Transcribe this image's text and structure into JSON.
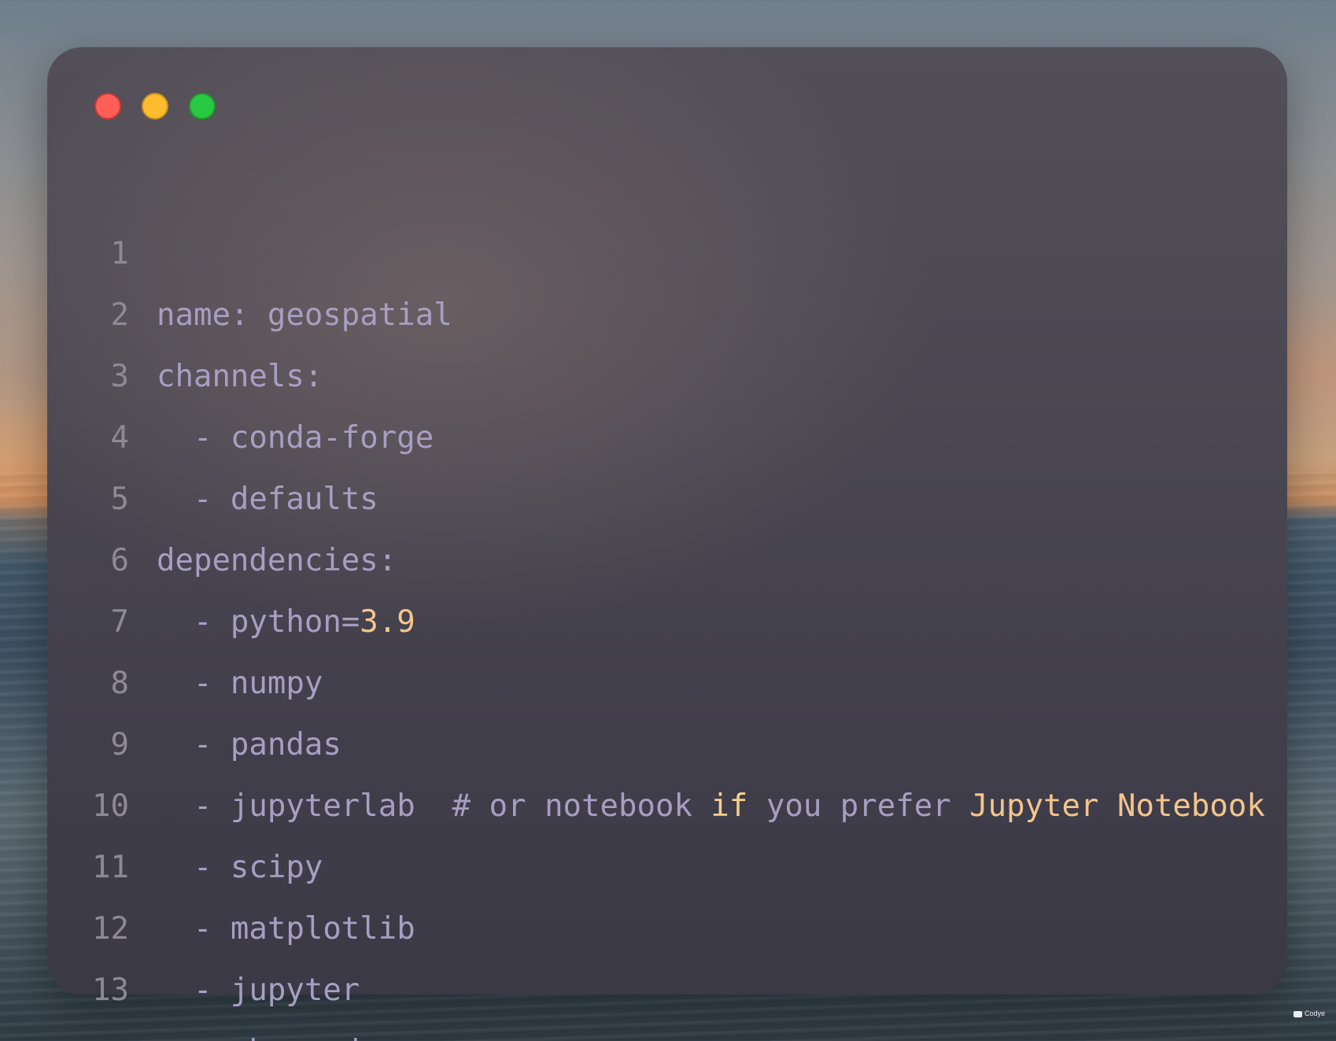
{
  "window": {
    "controls": [
      "close",
      "minimize",
      "maximize"
    ]
  },
  "colors": {
    "text": "#a79fc2",
    "line_number": "#8e8a95",
    "number": "#f5c58c",
    "keyword": "#f6d08e",
    "close": "#ff5f57",
    "minimize": "#febc2e",
    "maximize": "#28c840"
  },
  "code": {
    "lines": [
      {
        "n": "1",
        "text": "name: geospatial"
      },
      {
        "n": "2",
        "text": "channels:"
      },
      {
        "n": "3",
        "text": "  - conda-forge"
      },
      {
        "n": "4",
        "text": "  - defaults"
      },
      {
        "n": "5",
        "text": "dependencies:"
      },
      {
        "n": "6",
        "prefix": "  - python=",
        "number": "3.9"
      },
      {
        "n": "7",
        "text": "  - numpy"
      },
      {
        "n": "8",
        "text": "  - pandas"
      },
      {
        "n": "9",
        "prefix": "  - jupyterlab  # or notebook ",
        "keyword": "if",
        "middle": " you prefer ",
        "highlight": "Jupyter Notebook"
      },
      {
        "n": "10",
        "text": "  - scipy"
      },
      {
        "n": "11",
        "text": "  - matplotlib"
      },
      {
        "n": "12",
        "text": "  - jupyter"
      },
      {
        "n": "13",
        "text": "  - nb_conda"
      }
    ]
  },
  "watermark": {
    "label": "Codye",
    "icon": "codye-logo-icon"
  }
}
